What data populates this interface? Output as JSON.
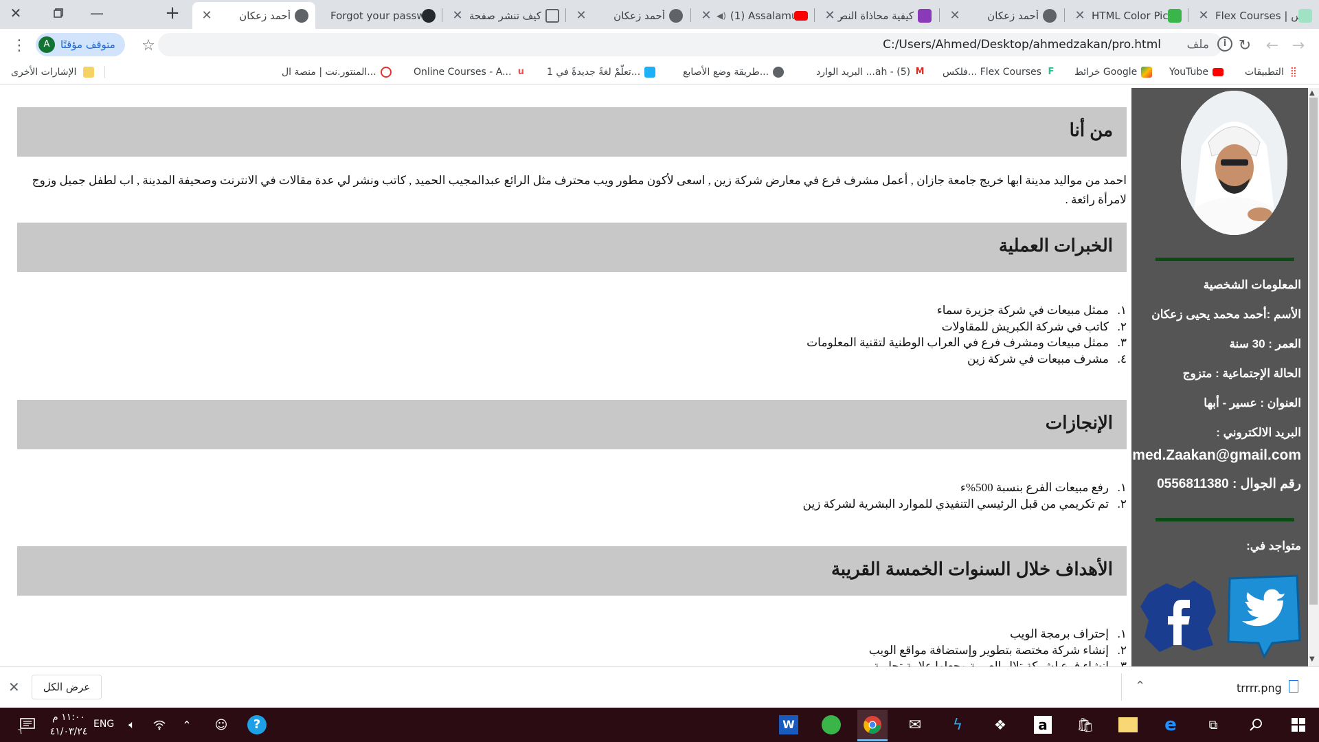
{
  "browser": {
    "tabs": [
      {
        "title": "Flex Courses | فلكس",
        "active": false
      },
      {
        "title": "HTML Color Picker",
        "active": false
      },
      {
        "title": "أحمد زعكان",
        "active": false
      },
      {
        "title": "كيفية محاذاة النص",
        "active": false
      },
      {
        "title": "(1) Assalamu",
        "active": false
      },
      {
        "title": "أحمد زعكان",
        "active": false
      },
      {
        "title": "كيف تنشر صفحة",
        "active": false
      },
      {
        "title": "Forgot your password",
        "active": false
      },
      {
        "title": "أحمد زعكان",
        "active": true
      }
    ],
    "new_tab_label": "+",
    "url": "C:/Users/Ahmed/Desktop/ahmedzakan/pro.html",
    "file_label": "ملف",
    "profile_status": "متوقف مؤقتًا",
    "profile_initial": "A",
    "bookmarks": [
      {
        "label": "التطبيقات",
        "icon": "apps-icon"
      },
      {
        "label": "YouTube",
        "icon": "youtube-icon"
      },
      {
        "label": "خرائط Google",
        "icon": "maps-icon"
      },
      {
        "label": "فلكس... Flex Courses",
        "icon": "flex-icon"
      },
      {
        "label": "البريد الوارد ...ah - (5)",
        "icon": "gmail-icon"
      },
      {
        "label": "طريقة وضع الأصابع...",
        "icon": "globe-icon"
      },
      {
        "label": "تعلّمْ لغةً جديدةً في 1...",
        "icon": "duolingo-icon"
      },
      {
        "label": "Online Courses - A...",
        "icon": "udemy-icon"
      },
      {
        "label": "المنتور.نت | منصة ال...",
        "icon": "pin-icon"
      }
    ],
    "other_bookmarks": "الإشارات الأخرى"
  },
  "sidebar": {
    "personal_info_title": "المعلومات الشخصية",
    "name_line": "الأسم :أحمد محمد يحيى زعكان",
    "age_line": "العمر : 30 سنة",
    "status_line": "الحالة الإجتماعية : متزوج",
    "address_line": "العنوان : عسير - أبها",
    "email_label": "البريد الالكتروني :",
    "email_value": "Ahmed.Zaakan@gmail.com",
    "phone_line": "رقم الجوال : 0556811380",
    "social_title": "متواجد في:",
    "bar_color": "#0b4a12",
    "bg_color": "#555555"
  },
  "main": {
    "about": {
      "heading": "من أنا",
      "text": "احمد من مواليد مدينة ابها خريج جامعة جازان , أعمل مشرف فرع في معارض شركة زين , اسعى لأكون مطور ويب محترف مثل الرائع عبدالمجيب الحميد , كاتب ونشر لي عدة مقالات في الانترنت وصحيفة المدينة , اب لطفل جميل وزوج لامرأة رائعة ."
    },
    "experience": {
      "heading": "الخبرات العملية",
      "items": [
        {
          "num": "١.",
          "text": "ممثل مبيعات في شركة جزيرة سماء"
        },
        {
          "num": "٢.",
          "text": "كاتب في شركة الكبريش للمقاولات"
        },
        {
          "num": "٣.",
          "text": "ممثل مبيعات ومشرف فرع في العراب الوطنية لتقنية المعلومات"
        },
        {
          "num": "٤.",
          "text": "مشرف مبيعات في شركة زين"
        }
      ]
    },
    "achievements": {
      "heading": "الإنجازات",
      "items": [
        {
          "num": "١.",
          "text": "رفع مبيعات الفرع بنسبة 500%ء"
        },
        {
          "num": "٢.",
          "text": "تم تكريمي من قبل الرئيسي التنفيذي للموارد البشرية لشركة زين"
        }
      ]
    },
    "goals": {
      "heading": "الأهداف خلال السنوات الخمسة القريبة",
      "items": [
        {
          "num": "١.",
          "text": "إحتراف برمجة الويب"
        },
        {
          "num": "٢.",
          "text": "إنشاء شركة مختصة بتطوير وإستضافة مواقع الويب"
        },
        {
          "num": "٣.",
          "text": "إنشاء فرع لشركة تلال العربية وجعلها علامة تجارية"
        }
      ]
    },
    "heading_bg": "#c8c8c8"
  },
  "downloads": {
    "show_all": "عرض الكل",
    "file_name": "trrrr.png"
  },
  "taskbar": {
    "language": "ENG",
    "time": "١١:٠٠ م",
    "date": "٤١/٠٣/٢٤",
    "notification_count": "٦"
  }
}
